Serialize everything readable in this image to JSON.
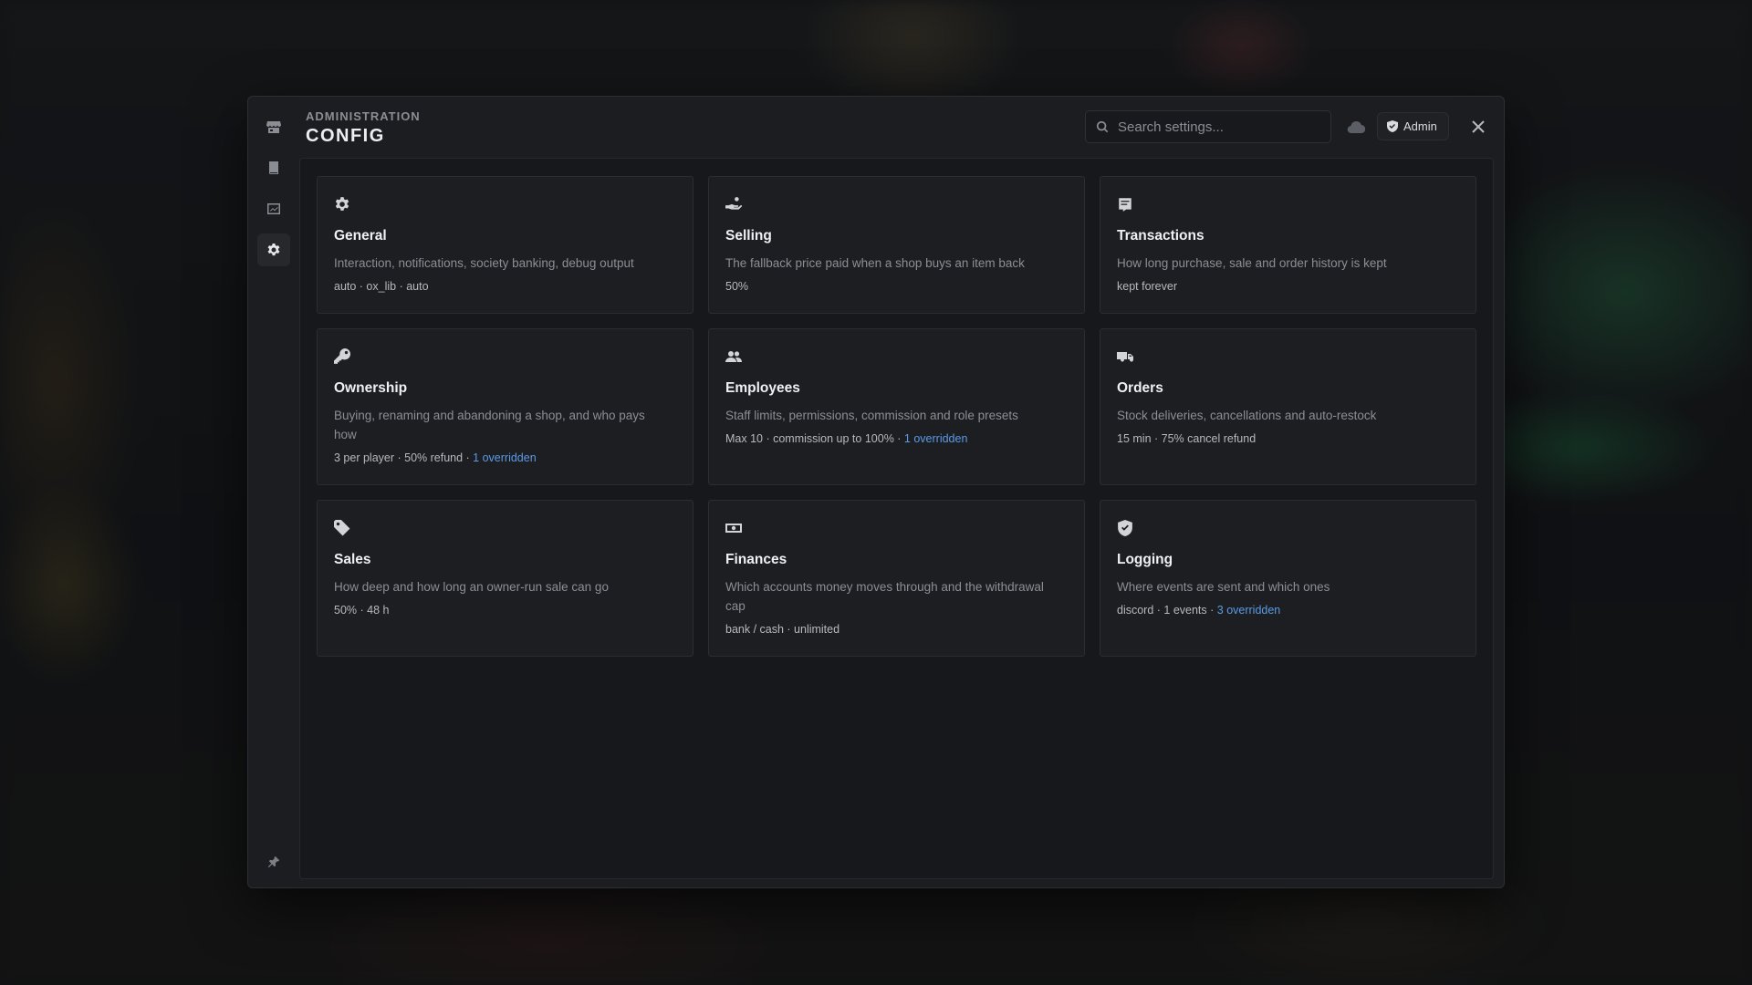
{
  "header": {
    "eyebrow": "ADMINISTRATION",
    "title": "CONFIG"
  },
  "search": {
    "placeholder": "Search settings..."
  },
  "admin_badge": {
    "label": "Admin"
  },
  "colors": {
    "accent_link": "#5b9be6",
    "card_bg": "#1d1e22",
    "window_bg": "#1c1d20"
  },
  "rail": {
    "items": [
      {
        "icon": "store-icon",
        "active": false
      },
      {
        "icon": "book-icon",
        "active": false
      },
      {
        "icon": "chart-icon",
        "active": false
      },
      {
        "icon": "gear-icon",
        "active": true
      }
    ],
    "bottom_icon": "pin-icon"
  },
  "cards": [
    {
      "icon": "gear-icon",
      "title": "General",
      "description": "Interaction, notifications, society banking, debug output",
      "meta": "auto · ox_lib · auto",
      "override": ""
    },
    {
      "icon": "hand-coins-icon",
      "title": "Selling",
      "description": "The fallback price paid when a shop buys an item back",
      "meta": "50%",
      "override": ""
    },
    {
      "icon": "receipt-icon",
      "title": "Transactions",
      "description": "How long purchase, sale and order history is kept",
      "meta": "kept forever",
      "override": ""
    },
    {
      "icon": "key-icon",
      "title": "Ownership",
      "description": "Buying, renaming and abandoning a shop, and who pays how",
      "meta": "3 per player · 50% refund · ",
      "override": "1 overridden"
    },
    {
      "icon": "users-icon",
      "title": "Employees",
      "description": "Staff limits, permissions, commission and role presets",
      "meta": "Max 10 · commission up to 100% · ",
      "override": "1 overridden"
    },
    {
      "icon": "truck-icon",
      "title": "Orders",
      "description": "Stock deliveries, cancellations and auto-restock",
      "meta": "15 min · 75% cancel refund",
      "override": ""
    },
    {
      "icon": "tag-icon",
      "title": "Sales",
      "description": "How deep and how long an owner-run sale can go",
      "meta": "50% · 48 h",
      "override": ""
    },
    {
      "icon": "money-icon",
      "title": "Finances",
      "description": "Which accounts money moves through and the withdrawal cap",
      "meta": "bank / cash · unlimited",
      "override": ""
    },
    {
      "icon": "shield-check-icon",
      "title": "Logging",
      "description": "Where events are sent and which ones",
      "meta": "discord · 1 events · ",
      "override": "3 overridden"
    }
  ]
}
